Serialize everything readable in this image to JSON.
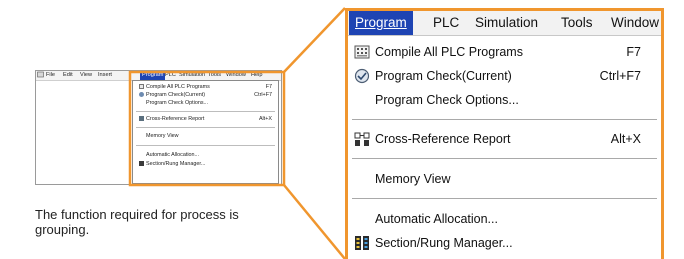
{
  "thumbnail": {
    "menubar": [
      "File",
      "Edit",
      "View",
      "Insert",
      "Program",
      "PLC",
      "Simulation",
      "Tools",
      "Window",
      "Help"
    ],
    "items": [
      {
        "label": "Compile All PLC Programs",
        "shortcut": "F7",
        "icon": "compile-icon"
      },
      {
        "label": "Program Check(Current)",
        "shortcut": "Ctrl+F7",
        "icon": "program-check-icon"
      },
      {
        "label": "Program Check Options...",
        "shortcut": "",
        "icon": ""
      },
      {
        "label": "Cross-Reference Report",
        "shortcut": "Alt+X",
        "icon": "cross-reference-icon"
      },
      {
        "label": "Memory View",
        "shortcut": "",
        "icon": ""
      },
      {
        "label": "Automatic Allocation...",
        "shortcut": "",
        "icon": ""
      },
      {
        "label": "Section/Rung Manager...",
        "shortcut": "",
        "icon": "section-manager-icon"
      }
    ]
  },
  "caption": "The function required for process is grouping.",
  "zoom": {
    "menubar": {
      "program": "Program",
      "plc": "PLC",
      "simulation": "Simulation",
      "tools": "Tools",
      "window": "Window"
    },
    "items": {
      "compile": {
        "label": "Compile All PLC Programs",
        "shortcut": "F7"
      },
      "check": {
        "label": "Program Check(Current)",
        "shortcut": "Ctrl+F7"
      },
      "check_options": {
        "label": "Program Check Options..."
      },
      "cross_ref": {
        "label": "Cross-Reference Report",
        "shortcut": "Alt+X"
      },
      "memory": {
        "label": "Memory View"
      },
      "auto_alloc": {
        "label": "Automatic Allocation..."
      },
      "section": {
        "label": "Section/Rung Manager..."
      }
    }
  },
  "colors": {
    "accent_orange": "#f0962e",
    "menu_highlight": "#1e44b3"
  }
}
